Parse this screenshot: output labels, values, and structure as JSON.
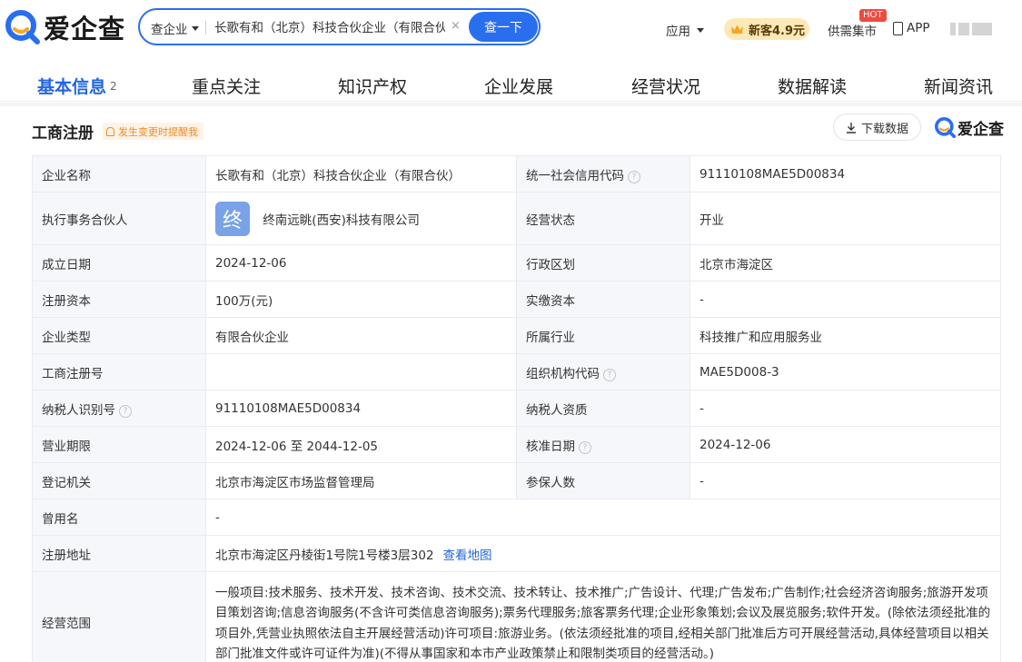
{
  "brand": {
    "name": "爱企查"
  },
  "search": {
    "type_label": "查企业",
    "query": "长歌有和（北京）科技合伙企业（有限合伙",
    "clear_symbol": "×",
    "button_label": "查一下"
  },
  "topnav": {
    "apps_label": "应用",
    "promo_label": "新客4.9元",
    "market_label": "供需集市",
    "hot_badge": "HOT",
    "app_label": "APP"
  },
  "tabs": {
    "basic": "基本信息",
    "basic_count": "2",
    "focus": "重点关注",
    "ip": "知识产权",
    "development": "企业发展",
    "operation": "经营状况",
    "data": "数据解读",
    "news": "新闻资讯"
  },
  "section": {
    "title": "工商注册",
    "remind_label": "发生变更时提醒我",
    "download_label": "下载数据",
    "brand_small": "爱企查"
  },
  "info": {
    "company_name_label": "企业名称",
    "company_name": "长歌有和（北京）科技合伙企业（有限合伙）",
    "credit_code_label": "统一社会信用代码",
    "credit_code": "91110108MAE5D00834",
    "partner_label": "执行事务合伙人",
    "partner_logo_char": "终",
    "partner_name": "终南远眺(西安)科技有限公司",
    "status_label": "经营状态",
    "status": "开业",
    "founded_label": "成立日期",
    "founded": "2024-12-06",
    "region_label": "行政区划",
    "region": "北京市海淀区",
    "capital_label": "注册资本",
    "capital": "100万(元)",
    "paid_capital_label": "实缴资本",
    "paid_capital": "-",
    "type_label": "企业类型",
    "type": "有限合伙企业",
    "industry_label": "所属行业",
    "industry": "科技推广和应用服务业",
    "reg_no_label": "工商注册号",
    "reg_no": "",
    "org_code_label": "组织机构代码",
    "org_code": "MAE5D008-3",
    "tax_id_label": "纳税人识别号",
    "tax_id": "91110108MAE5D00834",
    "taxpayer_qual_label": "纳税人资质",
    "taxpayer_qual": "-",
    "term_label": "营业期限",
    "term": "2024-12-06 至 2044-12-05",
    "approval_date_label": "核准日期",
    "approval_date": "2024-12-06",
    "authority_label": "登记机关",
    "authority": "北京市海淀区市场监督管理局",
    "insured_label": "参保人数",
    "insured": "-",
    "former_name_label": "曾用名",
    "former_name": "-",
    "address_label": "注册地址",
    "address": "北京市海淀区丹棱街1号院1号楼3层302",
    "map_link": "查看地图",
    "scope_label": "经营范围",
    "scope": "一般项目:技术服务、技术开发、技术咨询、技术交流、技术转让、技术推广;广告设计、代理;广告发布;广告制作;社会经济咨询服务;旅游开发项目策划咨询;信息咨询服务(不含许可类信息咨询服务);票务代理服务;旅客票务代理;企业形象策划;会议及展览服务;软件开发。(除依法须经批准的项目外,凭营业执照依法自主开展经营活动)许可项目:旅游业务。(依法须经批准的项目,经相关部门批准后方可开展经营活动,具体经营项目以相关部门批准文件或许可证件为准)(不得从事国家和本市产业政策禁止和限制类项目的经营活动。)"
  },
  "colors": {
    "accent": "#2a6ef0",
    "tab_active": "#2266dd",
    "hot": "#f04a3e",
    "promo_bg": "#fde9b8",
    "remind": "#f08a24",
    "label_bg": "#f5f7fa"
  }
}
